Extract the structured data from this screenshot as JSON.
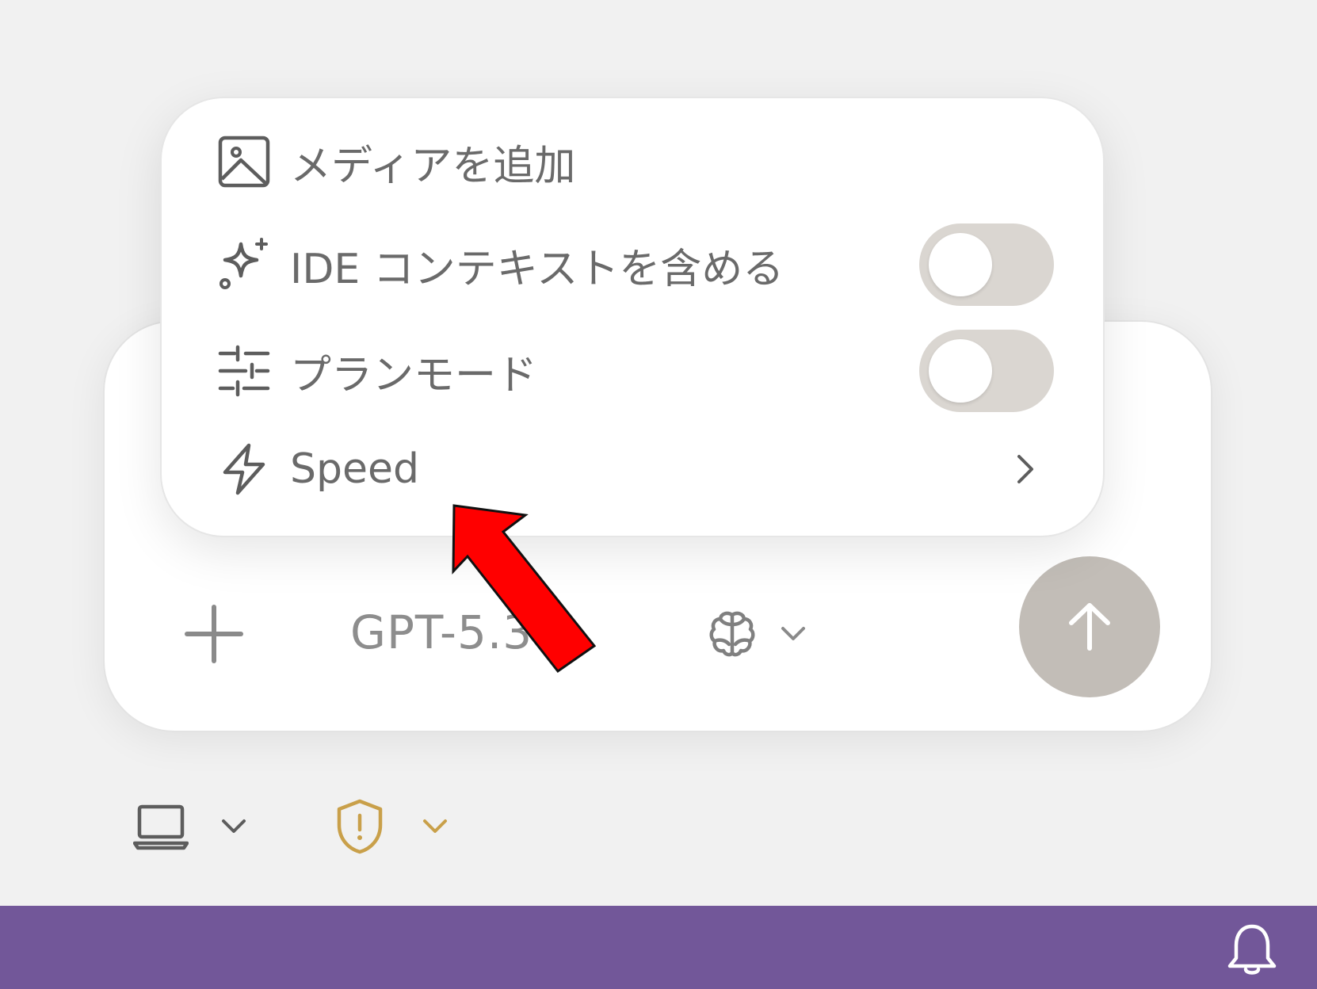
{
  "menu": {
    "items": [
      {
        "label": "メディアを追加",
        "icon": "image-icon"
      },
      {
        "label": "IDE コンテキストを含める",
        "icon": "sparkle-icon",
        "toggle": false
      },
      {
        "label": "プランモード",
        "icon": "sliders-icon",
        "toggle": false
      },
      {
        "label": "Speed",
        "icon": "lightning-icon",
        "submenu": true
      }
    ]
  },
  "composer": {
    "model_label": "GPT-5.3",
    "add_icon": "plus-icon",
    "reasoning_icon": "brain-icon",
    "send_icon": "arrow-up-icon"
  },
  "environment": {
    "local_icon": "laptop-icon",
    "permissions_icon": "shield-alert-icon"
  },
  "statusbar": {
    "notification_icon": "bell-icon"
  },
  "colors": {
    "background": "#f1f1f1",
    "statusbar": "#725799",
    "send_button": "#c2bdb7",
    "toggle_off": "#dad6d1",
    "warning": "#c9a04a",
    "annotation_arrow": "#ff0000"
  }
}
